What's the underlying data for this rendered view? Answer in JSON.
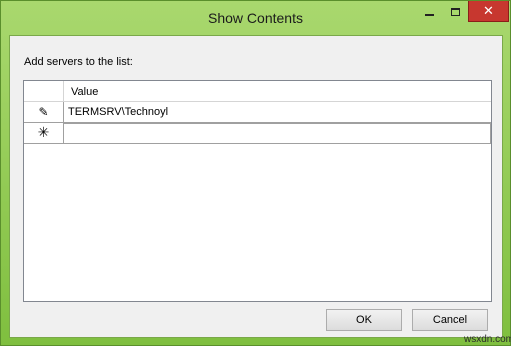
{
  "window": {
    "title": "Show Contents"
  },
  "caption": "Add servers to the list:",
  "grid": {
    "column_header": "Value",
    "rows": [
      {
        "marker": "pencil-icon",
        "value": "TERMSRV\\Technoyl"
      },
      {
        "marker": "asterisk-icon",
        "value": ""
      }
    ]
  },
  "buttons": {
    "ok": "OK",
    "cancel": "Cancel"
  },
  "watermark": "wsxdn.com",
  "colors": {
    "close_button": "#c7372f",
    "window_frame": "#7fbf3f"
  }
}
